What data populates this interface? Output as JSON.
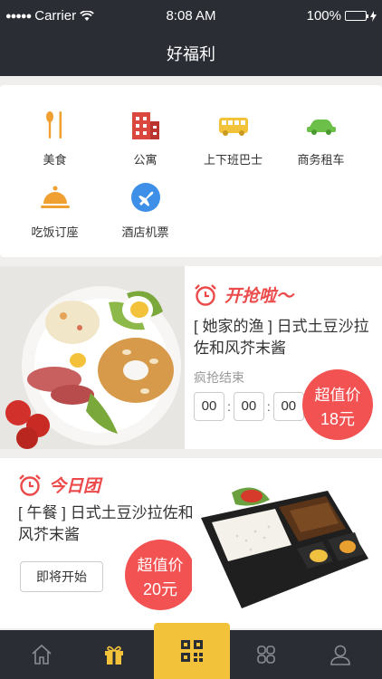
{
  "status_bar": {
    "carrier": "Carrier",
    "time": "8:08 AM",
    "battery": "100%"
  },
  "nav": {
    "title": "好福利"
  },
  "categories": [
    {
      "label": "美食",
      "icon": "utensils-icon",
      "color": "#f0a030"
    },
    {
      "label": "公寓",
      "icon": "building-icon",
      "color": "#d9473f"
    },
    {
      "label": "上下班巴士",
      "icon": "bus-icon",
      "color": "#f2c23a"
    },
    {
      "label": "商务租车",
      "icon": "car-icon",
      "color": "#6cc04a"
    },
    {
      "label": "吃饭订座",
      "icon": "cloche-icon",
      "color": "#f0a030"
    },
    {
      "label": "酒店机票",
      "icon": "plane-icon",
      "color": "#3d8fe8"
    }
  ],
  "deal_flash": {
    "tag": "开抢啦～",
    "title": "[ 她家的渔 ] 日式土豆沙拉佐和风芥末酱",
    "ended_label": "疯抢结束",
    "timer": [
      "00",
      "00",
      "00"
    ],
    "badge_text": "超值价",
    "price": "18元"
  },
  "deal_today": {
    "tag": "今日团",
    "title": "[ 午餐 ] 日式土豆沙拉佐和风芥末酱",
    "button": "即将开始",
    "badge_text": "超值价",
    "price": "20元"
  },
  "tab_bar": [
    {
      "icon": "home-icon",
      "active": false
    },
    {
      "icon": "gift-icon",
      "active": false
    },
    {
      "icon": "qr-code-icon",
      "active": true
    },
    {
      "icon": "grid-icon",
      "active": false
    },
    {
      "icon": "user-icon",
      "active": false
    }
  ],
  "colors": {
    "dark": "#2b2d35",
    "accent_red": "#f25252",
    "accent_yellow": "#f2c23a"
  }
}
